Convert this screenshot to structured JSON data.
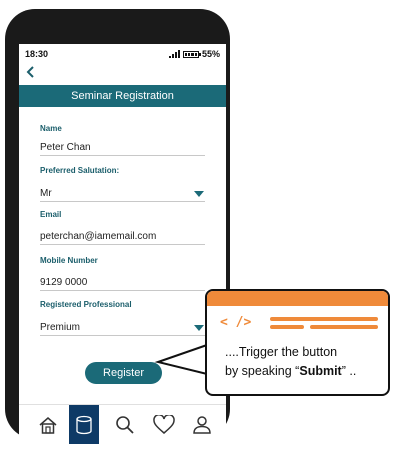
{
  "status_bar": {
    "time": "18:30",
    "battery": "55%"
  },
  "header": {
    "title": "Seminar Registration",
    "back_icon": "chevron-left-icon"
  },
  "form": {
    "name": {
      "label": "Name",
      "value": "Peter Chan"
    },
    "salutation": {
      "label": "Preferred Salutation:",
      "value": "Mr"
    },
    "email": {
      "label": "Email",
      "value": "peterchan@iamemail.com"
    },
    "mobile": {
      "label": "Mobile Number",
      "value": "9129 0000"
    },
    "professional": {
      "label": "Registered Professional",
      "value": "Premium"
    }
  },
  "register_button": {
    "label": "Register"
  },
  "bottom_nav": {
    "items": [
      {
        "icon": "home-icon"
      },
      {
        "icon": "database-icon",
        "active": true
      },
      {
        "icon": "search-icon"
      },
      {
        "icon": "heart-icon"
      },
      {
        "icon": "user-icon"
      }
    ]
  },
  "callout": {
    "code_symbol": "< />",
    "line1": "....Trigger the button",
    "line2_prefix": "by speaking “",
    "line2_keyword": "Submit",
    "line2_suffix": "” .."
  },
  "colors": {
    "primary": "#1b6a78",
    "accent": "#ef8a3a",
    "nav_active": "#0e3a66"
  }
}
